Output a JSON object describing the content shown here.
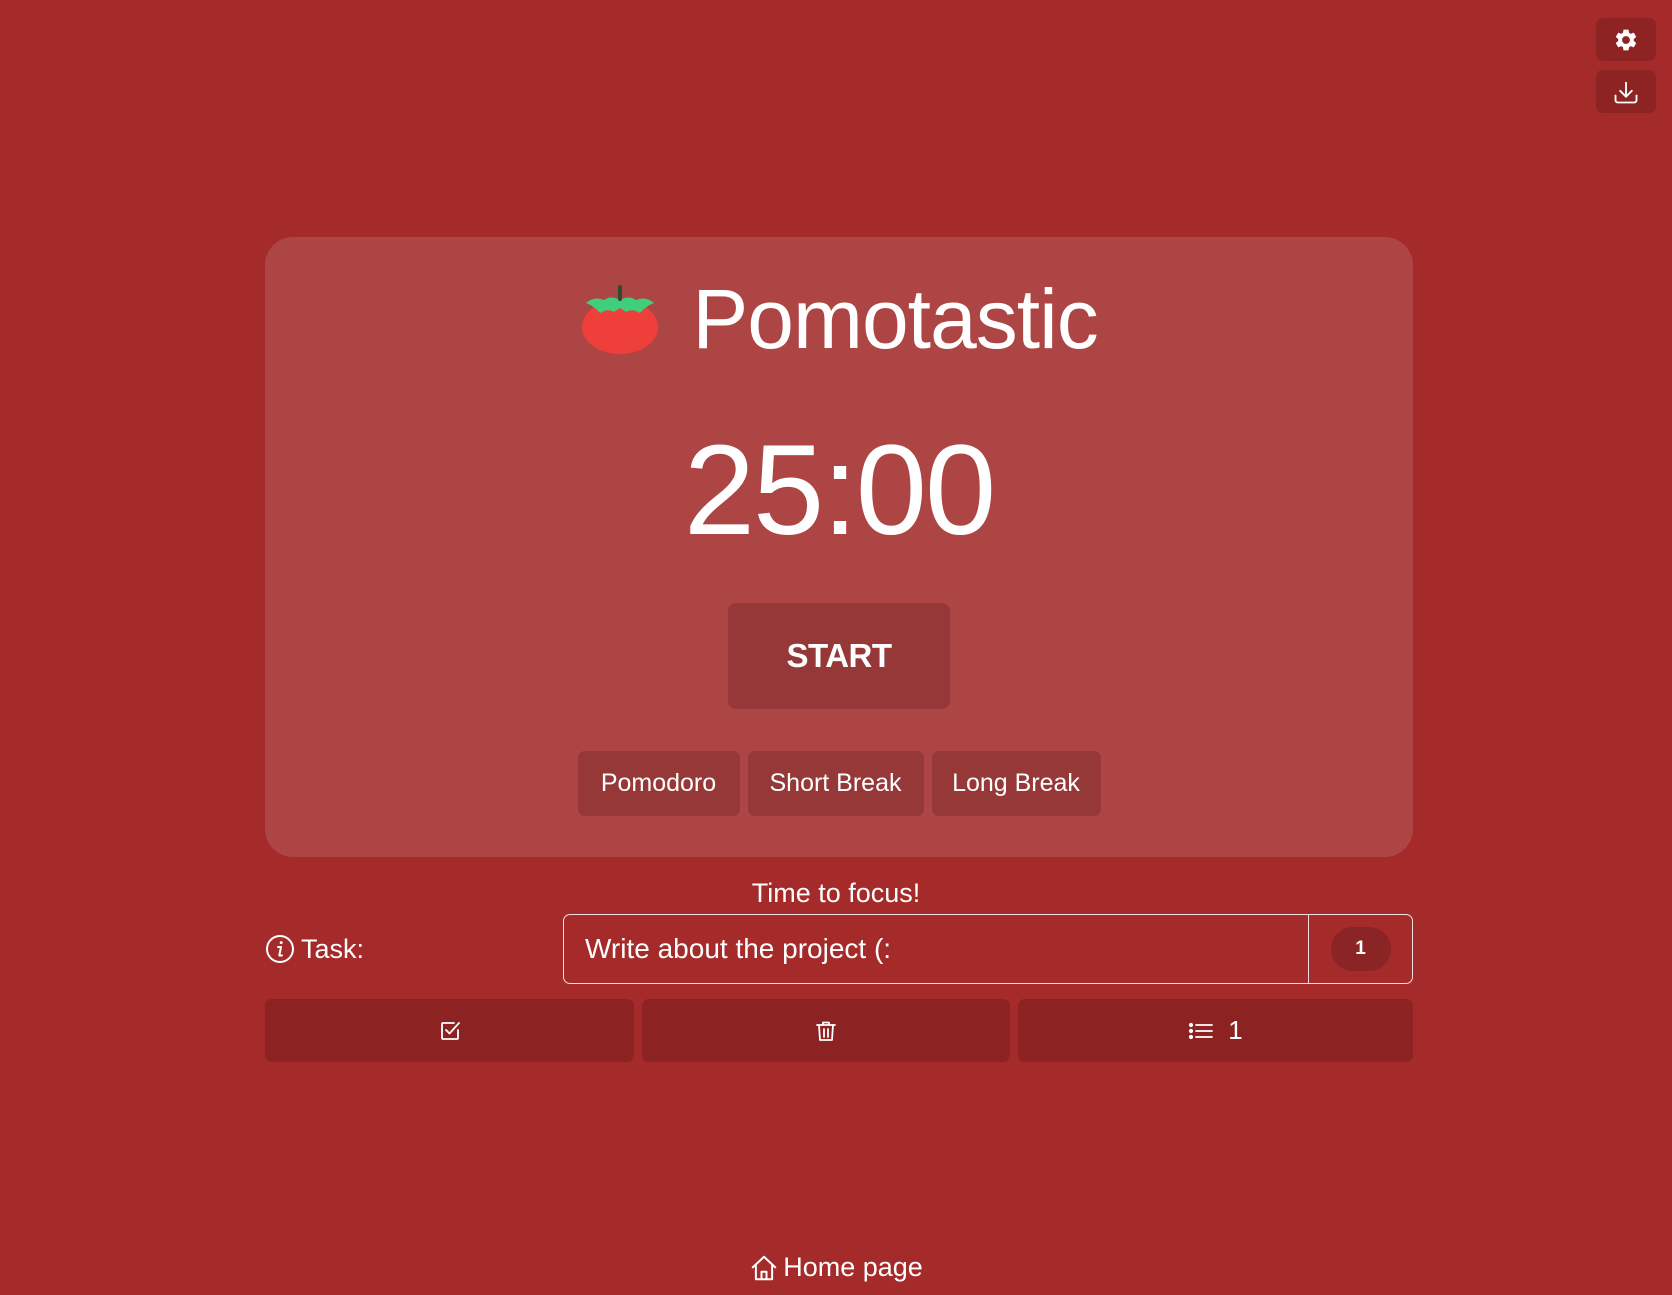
{
  "app": {
    "title": "Pomotastic",
    "logo_icon": "tomato-icon"
  },
  "toolbar": {
    "settings_icon": "gear-icon",
    "download_icon": "download-icon"
  },
  "timer": {
    "display": "25:00",
    "start_label": "START"
  },
  "modes": [
    {
      "label": "Pomodoro"
    },
    {
      "label": "Short Break"
    },
    {
      "label": "Long Break"
    }
  ],
  "status": {
    "message": "Time to focus!"
  },
  "task": {
    "label": "Task:",
    "info_icon": "info-icon",
    "value": "Write about the project (:",
    "pomodoro_count": "1"
  },
  "actions": {
    "complete_icon": "check-square-icon",
    "delete_icon": "trash-icon",
    "list_icon": "list-icon",
    "list_count": "1"
  },
  "footer": {
    "home_label": "Home page",
    "home_icon": "home-icon"
  },
  "colors": {
    "background": "#a52a2a",
    "card": "#ad4545",
    "button": "#973838",
    "action_button": "#8c2222",
    "text": "#ffffff"
  }
}
